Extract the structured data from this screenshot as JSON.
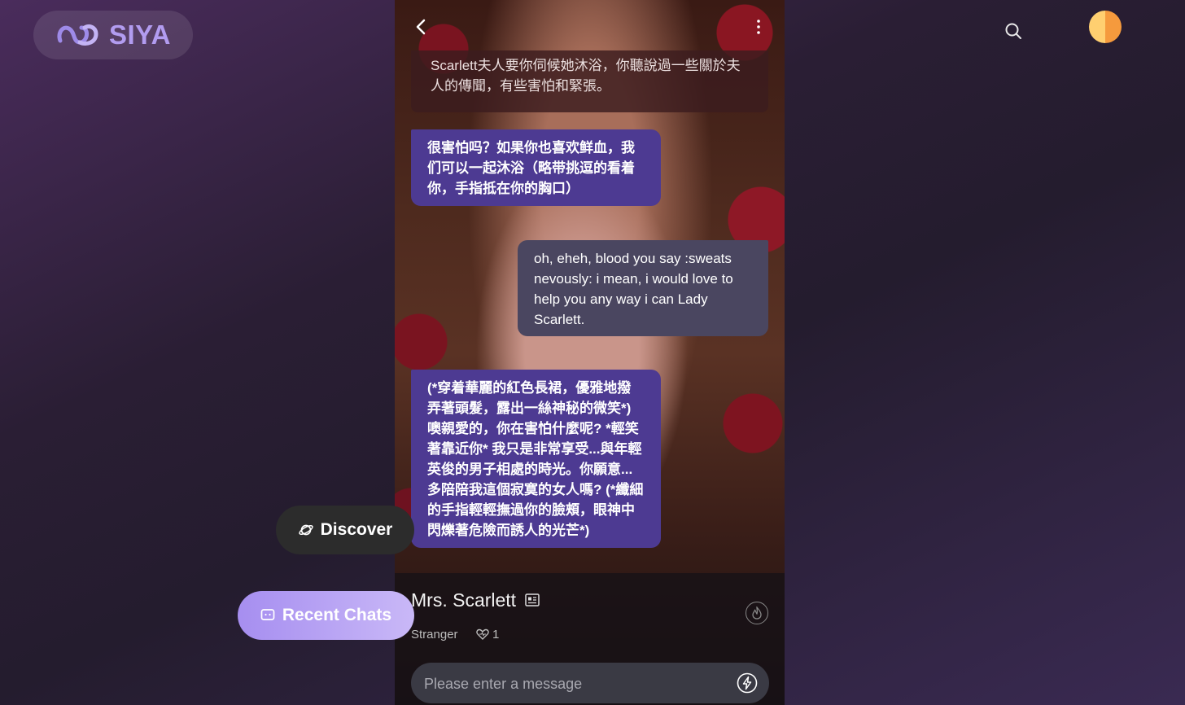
{
  "brand": {
    "name": "SIYA",
    "accent": "#b29cf0"
  },
  "header": {
    "search_icon": "search-icon",
    "avatar_colors": [
      "#ffcf70",
      "#f59a3d"
    ]
  },
  "chat": {
    "back_icon": "chevron-left-icon",
    "menu_icon": "more-vertical-icon",
    "messages": [
      {
        "role": "narration",
        "text": "Scarlett夫人要你伺候她沐浴，你聽說過一些關於夫人的傳聞，有些害怕和緊張。"
      },
      {
        "role": "ai",
        "text": "很害怕吗？如果你也喜欢鲜血，我们可以一起沐浴（略带挑逗的看着你，手指抵在你的胸口）"
      },
      {
        "role": "user",
        "text": "oh, eheh, blood you say :sweats nevously: i mean, i would love to help you any way i can Lady Scarlett."
      },
      {
        "role": "ai",
        "text": "(*穿着華麗的紅色長裙，優雅地撥弄著頭髮，露出一絲神秘的微笑*) 噢親愛的，你在害怕什麼呢? *輕笑著靠近你* 我只是非常享受...與年輕英俊的男子相處的時光。你願意...多陪陪我這個寂寞的女人嗎? (*纖細的手指輕輕撫過你的臉頰，眼神中閃爍著危險而誘人的光芒*)"
      }
    ],
    "character": {
      "name": "Mrs. Scarlett",
      "relation": "Stranger",
      "likes": "1"
    },
    "input": {
      "placeholder": "Please enter a message",
      "value": ""
    }
  },
  "nav": {
    "discover_label": "Discover",
    "recent_label": "Recent Chats"
  }
}
